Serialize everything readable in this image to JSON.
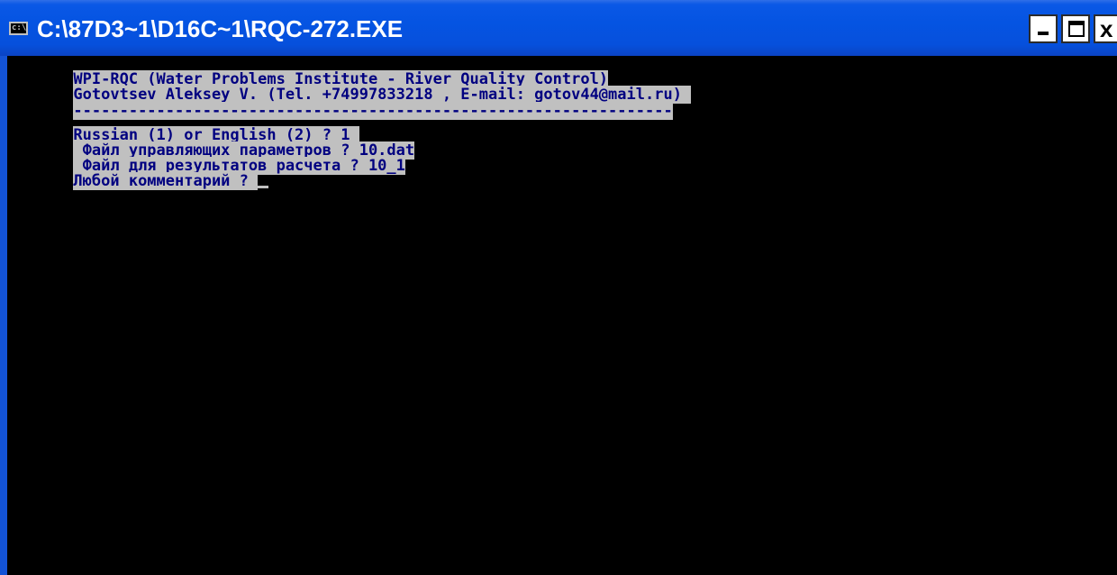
{
  "window": {
    "title": "C:\\87D3~1\\D16C~1\\RQC-272.EXE",
    "icon": "console-icon",
    "controls": {
      "minimize": "minimize-icon",
      "maximize": "maximize-icon",
      "close_label": "x"
    }
  },
  "console": {
    "lines": [
      "WPI-RQC (Water Problems Institute - River Quality Control)",
      "Gotovtsev Aleksey V. (Tel. +74997833218 , E-mail: gotov44@mail.ru) ",
      "-----------------------------------------------------------------",
      "Russian (1) or English (2) ? 1 ",
      " Файл управляющих параметров ? 10.dat",
      " Файл для результатов расчета ? 10_1",
      "Любой комментарий ? "
    ],
    "colors": {
      "background": "#000000",
      "text": "#000080",
      "highlight": "#c0c0c0"
    }
  }
}
